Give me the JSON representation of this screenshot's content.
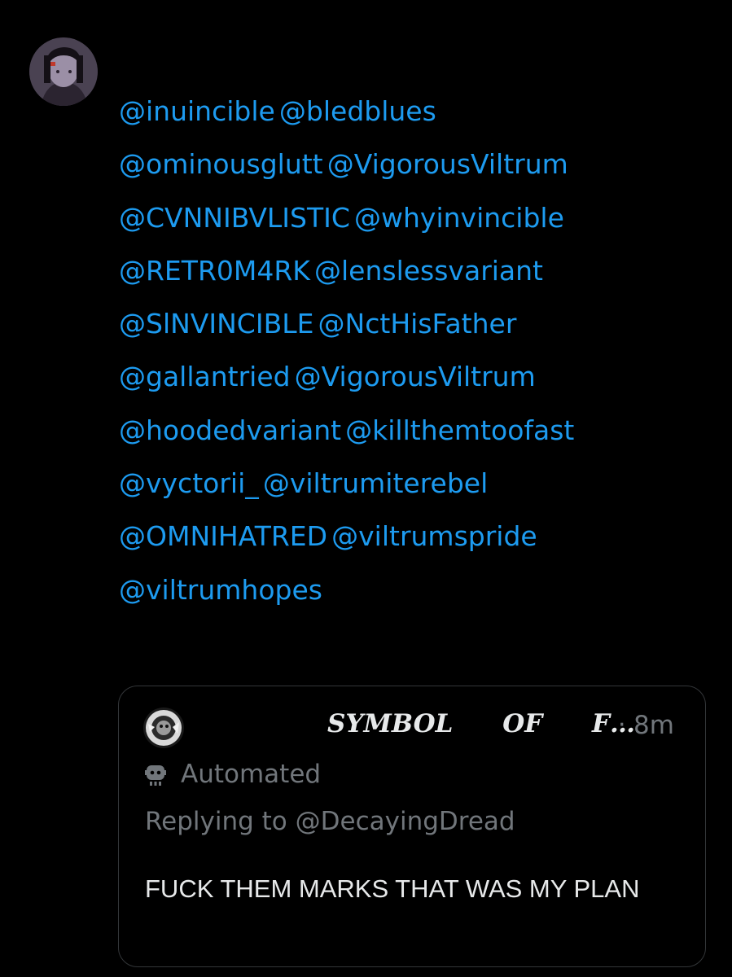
{
  "tweet": {
    "mentions": [
      [
        "@inuincible",
        "@bledblues"
      ],
      [
        "@ominousglutt",
        "@VigorousViltrum"
      ],
      [
        "@CVNNIBVLISTIC",
        "@whyinvincible"
      ],
      [
        "@RETR0M4RK",
        "@lenslessvariant"
      ],
      [
        "@SlNVINCIBLE",
        "@NctHisFather"
      ],
      [
        "@gallantried",
        "@VigorousViltrum"
      ],
      [
        "@hoodedvariant",
        "@killthemtoofast"
      ],
      [
        "@vyctorii_",
        "@viltrumiterebel"
      ],
      [
        "@OMNIHATRED",
        "@viltrumspride"
      ],
      [
        "@viltrumhopes"
      ]
    ],
    "mention_color": "#1d9bf0"
  },
  "quote": {
    "display_name": "SYMBOL OF F…",
    "dot": "·",
    "timestamp": "8m",
    "automated_label": "Automated",
    "replying_prefix": "Replying to",
    "replying_handle": "@DecayingDread",
    "text": "FUCK THEM MARKS THAT WAS MY PLAN",
    "border_color": "#333639",
    "muted_color": "#71767b"
  }
}
